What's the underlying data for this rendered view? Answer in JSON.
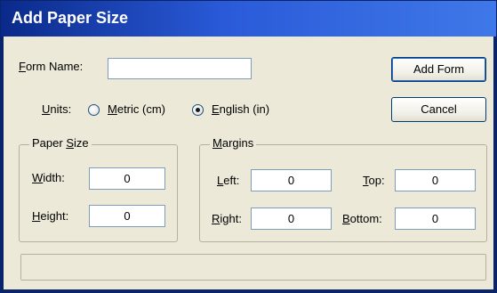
{
  "window": {
    "title": "Add Paper Size"
  },
  "form": {
    "name_label_u": "F",
    "name_label_rest": "orm Name:",
    "name_value": ""
  },
  "buttons": {
    "add_form": "Add Form",
    "cancel": "Cancel"
  },
  "units": {
    "label_u": "U",
    "label_rest": "nits:",
    "metric_u": "M",
    "metric_rest": "etric (cm)",
    "english_u": "E",
    "english_rest": "nglish (in)",
    "selected": "english"
  },
  "paper_size": {
    "legend_pre": "Paper ",
    "legend_u": "S",
    "legend_rest": "ize",
    "width_u": "W",
    "width_rest": "idth:",
    "width_value": "0",
    "height_u": "H",
    "height_rest": "eight:",
    "height_value": "0"
  },
  "margins": {
    "legend_u": "M",
    "legend_rest": "argins",
    "left_u": "L",
    "left_rest": "eft:",
    "left_value": "0",
    "top_u": "T",
    "top_rest": "op:",
    "top_value": "0",
    "right_u": "R",
    "right_rest": "ight:",
    "right_value": "0",
    "bottom_u": "B",
    "bottom_rest": "ottom:",
    "bottom_value": "0"
  },
  "status": {
    "text": ""
  },
  "colors": {
    "titlebar_start": "#0a2a8a",
    "titlebar_end": "#3f78e8",
    "dialog_face": "#ece9d8",
    "input_border": "#7f9db9"
  }
}
